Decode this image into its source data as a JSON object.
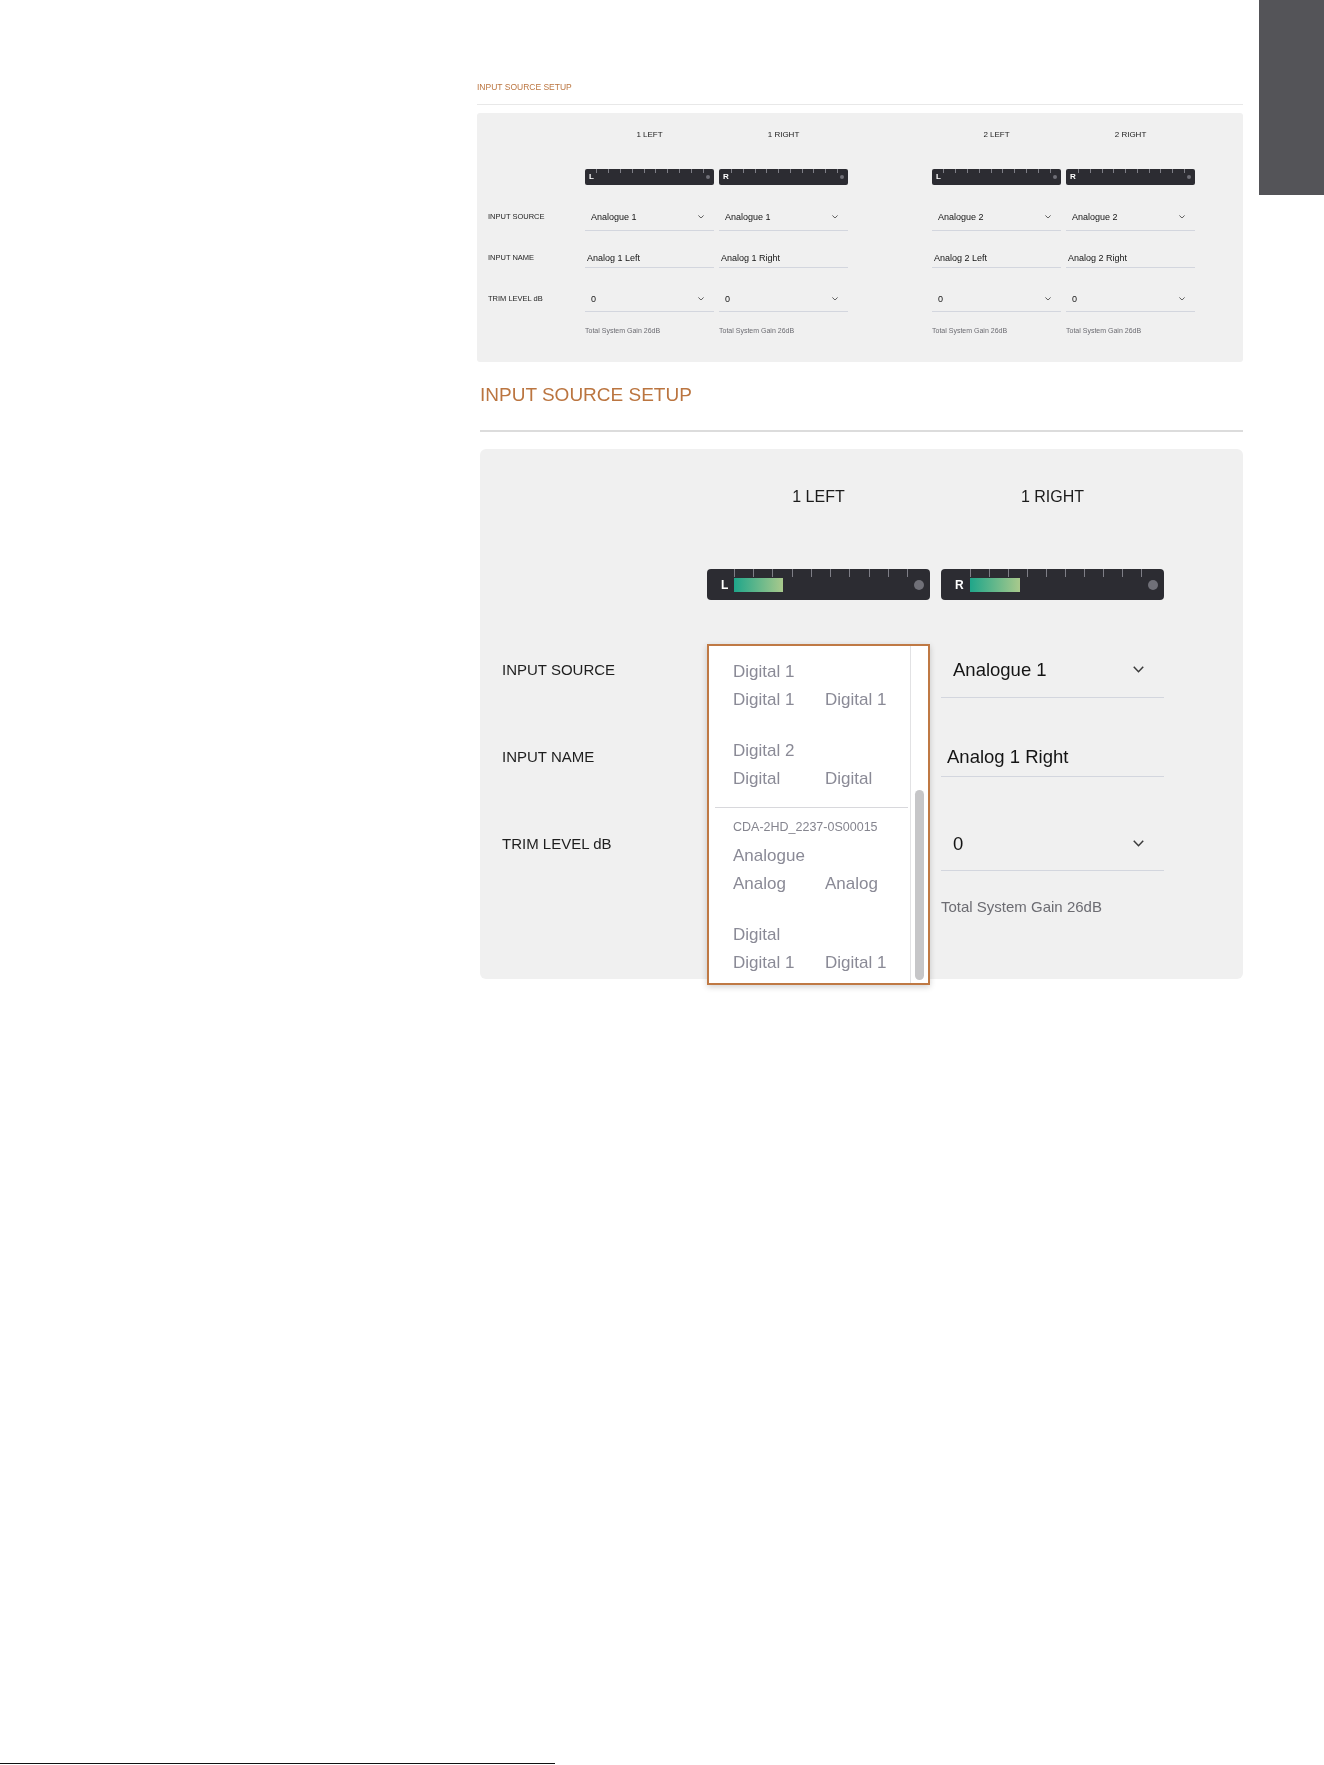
{
  "sections": [
    {
      "kind": "compact",
      "title": "INPUT SOURCE SETUP",
      "row_labels": [
        "INPUT SOURCE",
        "INPUT NAME",
        "TRIM LEVEL dB"
      ],
      "groups": [
        {
          "channels": [
            {
              "header": "1 LEFT",
              "meter": {
                "letter": "L"
              },
              "source": {
                "expanded": false,
                "value": "Analogue 1"
              },
              "name": "Analog 1 Left",
              "trim": "0",
              "gain_note": "Total System Gain 26dB"
            },
            {
              "header": "1 RIGHT",
              "meter": {
                "letter": "R"
              },
              "source": {
                "expanded": false,
                "value": "Analogue 1"
              },
              "name": "Analog 1 Right",
              "trim": "0",
              "gain_note": "Total System Gain 26dB"
            }
          ]
        },
        {
          "channels": [
            {
              "header": "2 LEFT",
              "meter": {
                "letter": "L"
              },
              "source": {
                "expanded": false,
                "value": "Analogue 2"
              },
              "name": "Analog 2 Left",
              "trim": "0",
              "gain_note": "Total System Gain 26dB"
            },
            {
              "header": "2 RIGHT",
              "meter": {
                "letter": "R"
              },
              "source": {
                "expanded": false,
                "value": "Analogue 2"
              },
              "name": "Analog 2 Right",
              "trim": "0",
              "gain_note": "Total System Gain 26dB"
            }
          ]
        }
      ]
    },
    {
      "kind": "large",
      "title": "INPUT SOURCE SETUP",
      "row_labels": [
        "INPUT SOURCE",
        "INPUT NAME",
        "TRIM LEVEL dB"
      ],
      "groups": [
        {
          "channels": [
            {
              "header": "1 LEFT",
              "meter": {
                "letter": "L",
                "level": 0.28
              },
              "source": {
                "expanded": true,
                "menu": [
                  {
                    "items": [
                      {
                        "label": "Digital 1",
                        "channels": [
                          "Digital 1",
                          "Digital 1"
                        ]
                      },
                      {
                        "label": "Digital 2",
                        "channels": [
                          "Digital",
                          "Digital"
                        ]
                      }
                    ]
                  },
                  {
                    "device": "CDA-2HD_2237-0S00015",
                    "items": [
                      {
                        "label": "Analogue",
                        "channels": [
                          "Analog",
                          "Analog"
                        ]
                      },
                      {
                        "label": "Digital",
                        "channels": [
                          "Digital 1",
                          "Digital 1"
                        ]
                      }
                    ]
                  }
                ]
              }
            },
            {
              "header": "1 RIGHT",
              "meter": {
                "letter": "R",
                "level": 0.29
              },
              "source": {
                "expanded": false,
                "value": "Analogue 1"
              },
              "name": "Analog 1 Right",
              "trim": "0",
              "gain_note": "Total System Gain 26dB"
            }
          ]
        }
      ]
    }
  ]
}
